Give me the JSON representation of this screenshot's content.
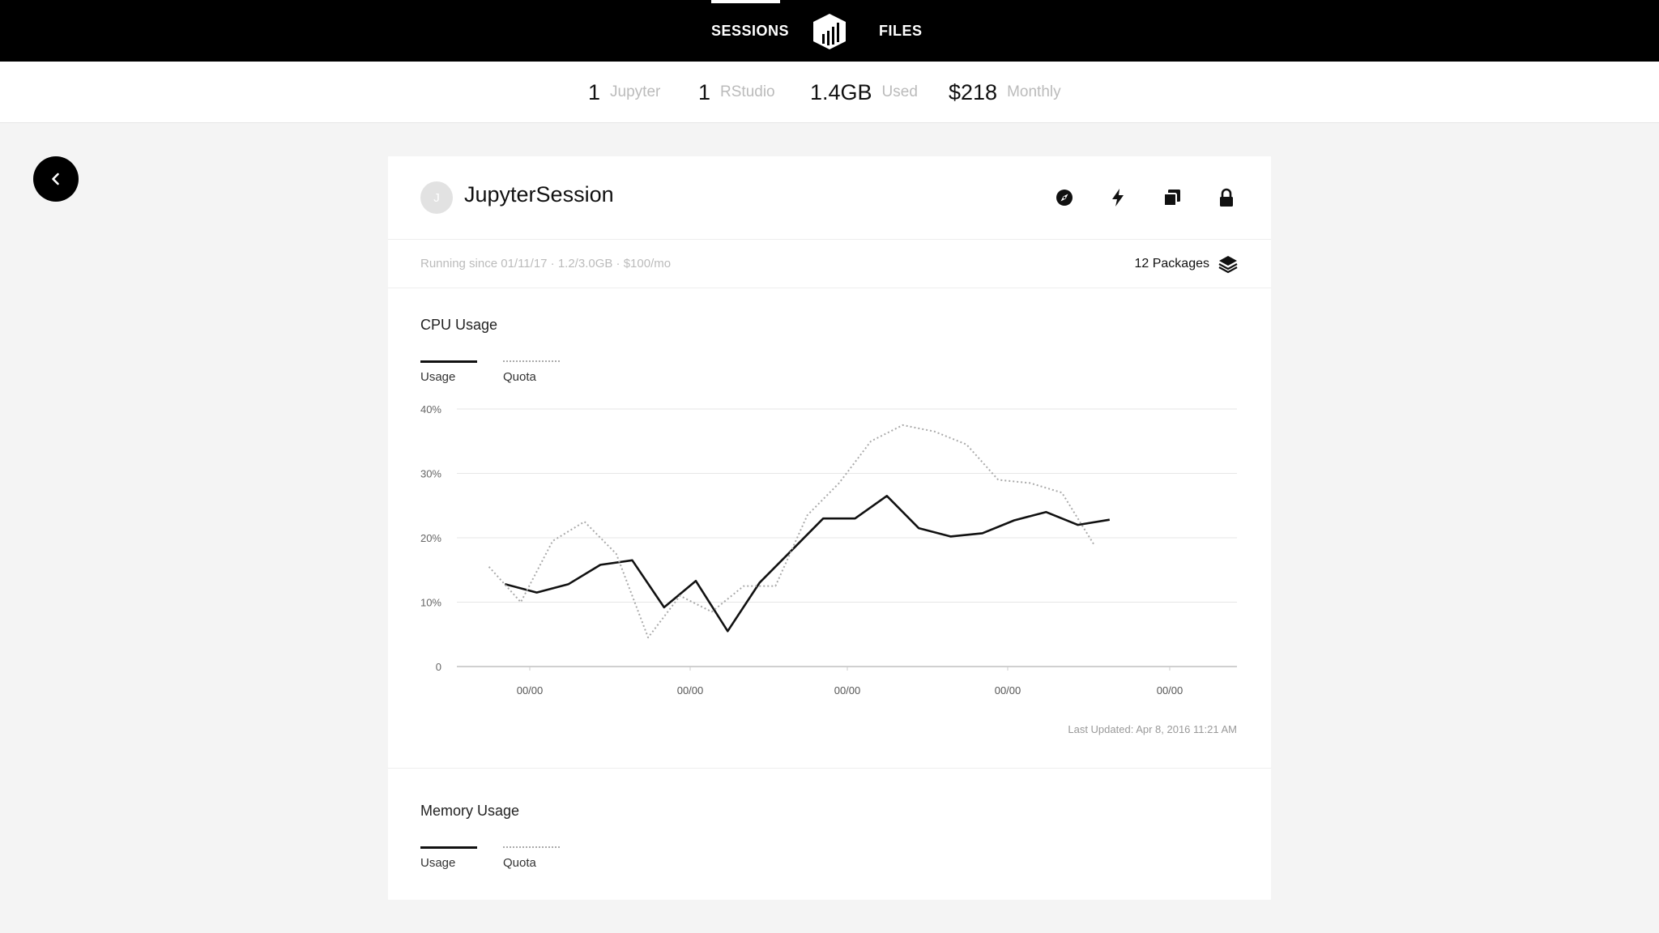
{
  "nav": {
    "sessions_label": "SESSIONS",
    "files_label": "FILES",
    "logo_icon": "bar-chart-shield-icon"
  },
  "stats": [
    {
      "value": "1",
      "label": "Jupyter"
    },
    {
      "value": "1",
      "label": "RStudio"
    },
    {
      "value": "1.4GB",
      "label": "Used"
    },
    {
      "value": "$218",
      "label": "Monthly"
    }
  ],
  "back_icon": "chevron-left-icon",
  "session": {
    "avatar_letter": "J",
    "title": "JupyterSession",
    "actions": [
      "compass-icon",
      "lightning-icon",
      "copy-icon",
      "lock-icon"
    ],
    "meta": "Running since 01/11/17 · 1.2/3.0GB · $100/mo",
    "packages_label": "12 Packages",
    "packages_icon": "layers-icon"
  },
  "cpu": {
    "title": "CPU Usage",
    "legend_usage": "Usage",
    "legend_quota": "Quota",
    "last_updated": "Last Updated: Apr 8, 2016 11:21 AM"
  },
  "memory": {
    "title": "Memory Usage",
    "legend_usage": "Usage",
    "legend_quota": "Quota"
  },
  "colors": {
    "usage_line": "#111111",
    "quota_line": "#aaaaaa",
    "grid": "#e6e6e6"
  },
  "chart_data": {
    "type": "line",
    "title": "CPU Usage",
    "ylim": [
      0,
      40
    ],
    "y_ticks": [
      "0",
      "10%",
      "20%",
      "30%",
      "40%"
    ],
    "x_ticks": [
      "00/00",
      "00/00",
      "00/00",
      "00/00",
      "00/00"
    ],
    "xlim": [
      0,
      24
    ],
    "grid": true,
    "legend": "top-left",
    "series": [
      {
        "name": "Usage",
        "style": "solid",
        "x": [
          1,
          2,
          3,
          4,
          5,
          6,
          7,
          8,
          9,
          10,
          11,
          12,
          13,
          14,
          15,
          16,
          17,
          18,
          19,
          20,
          21,
          22,
          23
        ],
        "y": [
          12.8,
          11.5,
          12.8,
          15.8,
          16.5,
          9.2,
          13.3,
          5.5,
          13.0,
          18.0,
          23.0,
          23.0,
          26.5,
          21.5,
          20.2,
          20.7,
          22.7,
          24.0,
          22.0,
          22.8,
          null,
          null,
          null
        ]
      },
      {
        "name": "Quota",
        "style": "dotted",
        "x": [
          0.5,
          1.5,
          2.5,
          3.5,
          4.5,
          5.5,
          6.5,
          7.5,
          8.5,
          9.5,
          10.5,
          11.5,
          12.5,
          13.5,
          14.5,
          15.5,
          16.5,
          17.5,
          18.5,
          19.5
        ],
        "y": [
          15.5,
          10.0,
          19.5,
          22.5,
          17.5,
          4.5,
          11.0,
          8.5,
          12.5,
          12.5,
          23.5,
          28.5,
          35.0,
          37.5,
          36.5,
          34.5,
          29.0,
          28.5,
          27.0,
          19.0
        ]
      }
    ]
  }
}
